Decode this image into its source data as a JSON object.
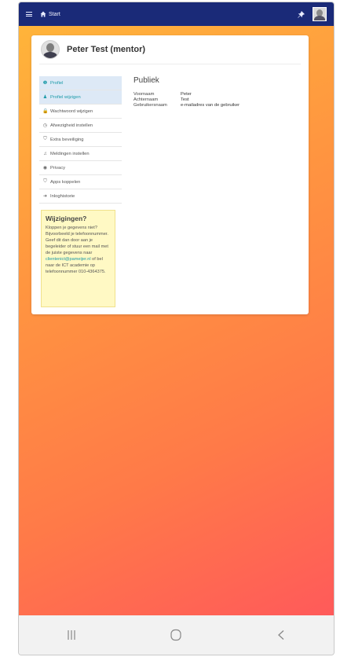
{
  "topbar": {
    "start_label": "Start"
  },
  "profile": {
    "name": "Peter Test (mentor)"
  },
  "sidebar": {
    "items": [
      {
        "label": "Profiel",
        "icon": "info-circle-icon",
        "glyph": "❶",
        "active": true
      },
      {
        "label": "Profiel wijzigen",
        "icon": "user-icon",
        "glyph": "♟",
        "active": true
      },
      {
        "label": "Wachtwoord wijzigen",
        "icon": "lock-icon",
        "glyph": "🔒",
        "active": false
      },
      {
        "label": "Afwezigheid instellen",
        "icon": "clock-icon",
        "glyph": "◷",
        "active": false
      },
      {
        "label": "Extra beveiliging",
        "icon": "shield-icon",
        "glyph": "⛉",
        "active": false
      },
      {
        "label": "Meldingen instellen",
        "icon": "bell-icon",
        "glyph": "♫",
        "active": false
      },
      {
        "label": "Privacy",
        "icon": "eye-icon",
        "glyph": "◉",
        "active": false
      },
      {
        "label": "Apps koppelen",
        "icon": "shield-icon",
        "glyph": "⛉",
        "active": false
      },
      {
        "label": "Inloghistorie",
        "icon": "sign-in-icon",
        "glyph": "➜",
        "active": false
      }
    ]
  },
  "notice": {
    "title": "Wijzigingen?",
    "text_before": "Kloppen je gegevens niet? Bijvoorbeeld je telefoonnummer. Geef dit dan door aan je begeleider of stuur een mail met de juiste gegevens naar",
    "email": "clientenict@pameijer.nl",
    "text_after": "of bel naar de ICT academie op telefoonnummer 010-4364375."
  },
  "main": {
    "section_title": "Publiek",
    "fields": [
      {
        "label": "Voornaam",
        "value": "Peter"
      },
      {
        "label": "Achternaam",
        "value": "Test"
      },
      {
        "label": "Gebruikersnaam",
        "value": "e-mailadres van de gebruiker"
      }
    ]
  },
  "colors": {
    "topbar": "#1a2a78",
    "accent": "#1a9aa8",
    "gradient_start": "#ffb43a",
    "gradient_end": "#ff5a5a",
    "notice_bg": "#fff9c4"
  }
}
